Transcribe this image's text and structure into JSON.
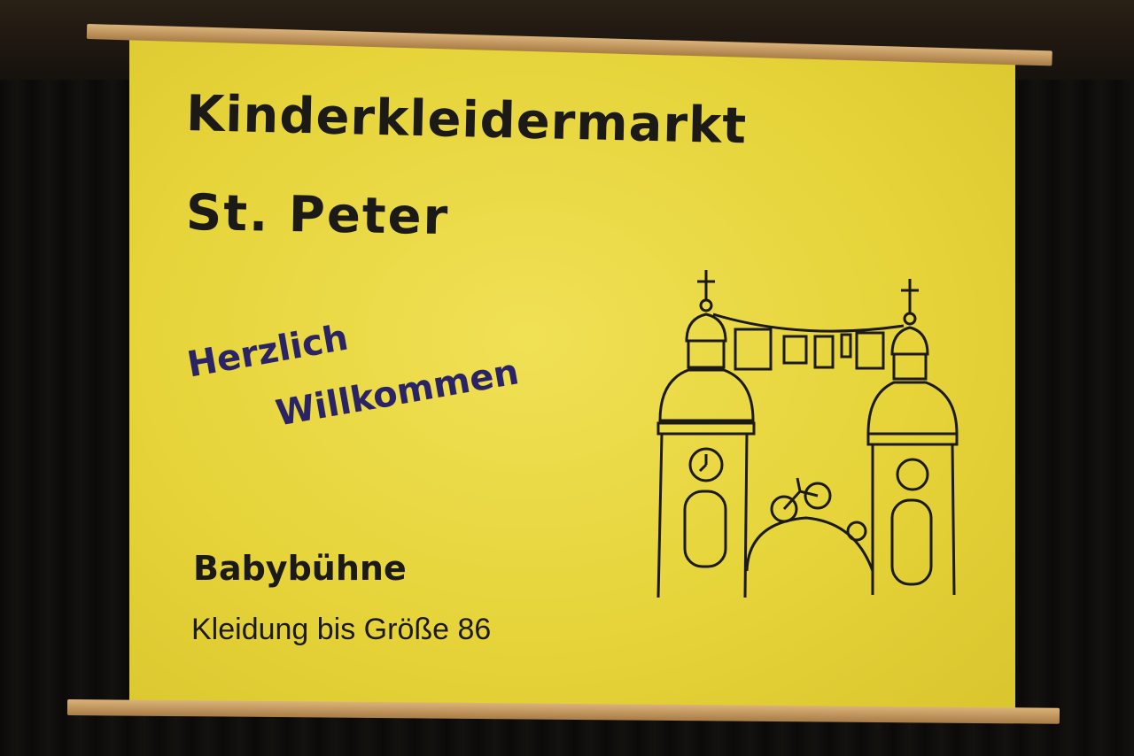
{
  "banner": {
    "title_line1": "Kinderkleidermarkt",
    "title_line2": "St. Peter",
    "greeting_line1": "Herzlich",
    "greeting_line2": "Willkommen",
    "section": "Babybühne",
    "subtitle": "Kleidung bis Größe 86",
    "colors": {
      "banner": "#e6d43a",
      "text": "#1b1a16",
      "greeting": "#2a2466"
    }
  }
}
